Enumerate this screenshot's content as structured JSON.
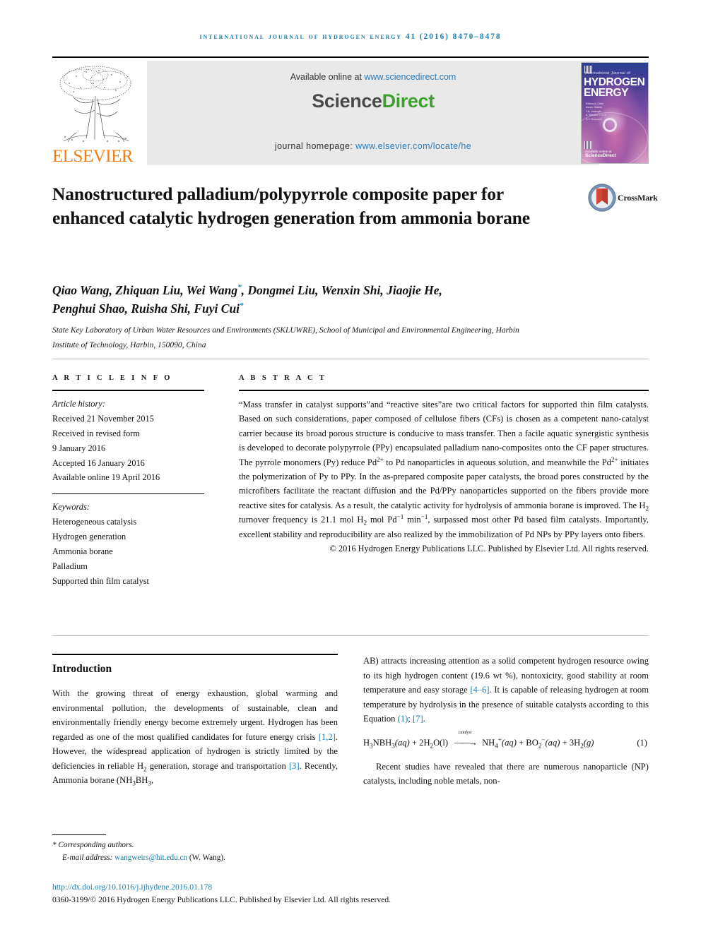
{
  "running_head": "international journal of hydrogen energy 41 (2016) 8470–8478",
  "banner": {
    "available_prefix": "Available online at ",
    "available_url": "www.sciencedirect.com",
    "logo_sci": "Science",
    "logo_direct": "Direct",
    "homepage_prefix": "journal homepage: ",
    "homepage_url": "www.elsevier.com/locate/he",
    "elsevier_wordmark": "ELSEVIER",
    "cover": {
      "line_small": "International Journal of",
      "line_big_1": "HYDROGEN",
      "line_big_2": "ENERGY",
      "editors": "Editors-in-Chief: T. Nejat Veziroglu\nAssociate Editors: A. Mahdavi, C.C. Sorrelon, R.H. Alonsoke,\nD.Y. Goswami, M. Bolhain,\nLu-Chu Tsai, E. and C.C. Sorrelon",
      "sciencedirect": "ScienceDirect",
      "sciencedirect_small": "Available online at"
    }
  },
  "crossmark": {
    "label": "CrossMark"
  },
  "title": "Nanostructured palladium/polypyrrole composite paper for enhanced catalytic hydrogen generation from ammonia borane",
  "authors_line1_a": "Qiao Wang, Zhiquan Liu, Wei Wang",
  "authors_line1_b": ", Dongmei Liu, Wenxin Shi, Jiaojie He,",
  "authors_line2_a": "Penghui Shao, Ruisha Shi, Fuyi Cui",
  "author_star": "*",
  "affiliation": "State Key Laboratory of Urban Water Resources and Environments (SKLUWRE), School of Municipal and Environmental Engineering, Harbin Institute of Technology, Harbin, 150090, China",
  "article_info": {
    "heading": "A R T I C L E   I N F O",
    "history_label": "Article history:",
    "history": [
      "Received 21 November 2015",
      "Received in revised form",
      "9 January 2016",
      "Accepted 16 January 2016",
      "Available online 19 April 2016"
    ],
    "keywords_label": "Keywords:",
    "keywords": [
      "Heterogeneous catalysis",
      "Hydrogen generation",
      "Ammonia borane",
      "Palladium",
      "Supported thin film catalyst"
    ]
  },
  "abstract": {
    "heading": "A B S T R A C T",
    "p1_a": "“Mass transfer in catalyst supports”and “reactive sites”are two critical factors for supported thin film catalysts. Based on such considerations, paper composed of cellulose fibers (CFs) is chosen as a competent nano-catalyst carrier because its broad porous structure is conducive to mass transfer. Then a facile aquatic synergistic synthesis is developed to decorate polypyrrole (PPy) encapsulated palladium nano-composites onto the CF paper structures. The pyrrole monomers (Py) reduce Pd",
    "sup1": "2+",
    "p1_b": " to Pd nanoparticles in aqueous solution, and meanwhile the Pd",
    "sup2": "2+",
    "p1_c": " initiates the polymerization of Py to PPy. In the as-prepared composite paper catalysts, the broad pores constructed by the microfibers facilitate the reactant diffusion and the Pd/PPy nanoparticles supported on the fibers provide more reactive sites for catalysis. As a result, the catalytic activity for hydrolysis of ammonia borane is improved. The H",
    "sub_h2a": "2",
    "p1_d": " turnover frequency is 21.1 mol H",
    "sub_h2b": "2",
    "p1_e": " mol Pd",
    "sup_neg1a": "−1",
    "p1_f": " min",
    "sup_neg1b": "−1",
    "p1_g": ", surpassed most other Pd based film catalysts. Importantly, excellent stability and reproducibility are also realized by the immobilization of Pd NPs by PPy layers onto fibers.",
    "copyright": "© 2016 Hydrogen Energy Publications LLC. Published by Elsevier Ltd. All rights reserved."
  },
  "body": {
    "intro_heading": "Introduction",
    "left_p1_a": "With the growing threat of energy exhaustion, global warming and environmental pollution, the developments of sustainable, clean and environmentally friendly energy become extremely urgent. Hydrogen has been regarded as one of the most qualified candidates for future energy crisis ",
    "left_cite_12": "[1,2]",
    "left_p1_b": ". However, the widespread application of hydrogen is strictly limited by the deficiencies in reliable H",
    "left_sub_2": "2",
    "left_p1_c": " generation, storage and transportation ",
    "left_cite_3": "[3]",
    "left_p1_d": ". Recently, Ammonia borane (NH",
    "left_sub_3a": "3",
    "left_p1_e": "BH",
    "left_sub_3b": "3",
    "left_p1_f": ",",
    "right_p1_a": "AB) attracts increasing attention as a solid competent hydrogen resource owing to its high hydrogen content (19.6 wt %), nontoxicity, good stability at room temperature and easy storage ",
    "right_cite_46": "[4–6]",
    "right_p1_b": ". It is capable of releasing hydrogen at room temperature by hydrolysis in the presence of suitable catalysts according to this Equation ",
    "right_cite_eq1": "(1)",
    "right_p1_c": "; ",
    "right_cite_7": "[7]",
    "right_p1_d": ".",
    "equation": {
      "lhs_h3": "H",
      "lhs_sub3a": "3",
      "lhs_nbh": "NBH",
      "lhs_sub3b": "3",
      "lhs_aq": "(aq)",
      "plus1": " + 2H",
      "lhs_sub2": "2",
      "lhs_o": "O(l)",
      "arrow_label": "catalyst",
      "rhs_nh4": "NH",
      "rhs_sub4": "4",
      "rhs_sup_plus": "+",
      "rhs_aq1": "(aq)",
      "plus2": " + BO",
      "rhs_sub2": "2",
      "rhs_sup_minus": "−",
      "rhs_aq2": "(aq)",
      "plus3": " + 3H",
      "rhs_sub2b": "2",
      "rhs_g": "(g)",
      "number": "(1)"
    },
    "right_p2": "Recent studies have revealed that there are numerous nanoparticle (NP) catalysts, including noble metals, non-"
  },
  "footer": {
    "corresponding": "* Corresponding authors.",
    "email_label": "E-mail address: ",
    "email": "wangweirs@hit.edu.cn",
    "email_suffix": " (W. Wang).",
    "doi": "http://dx.doi.org/10.1016/j.ijhydene.2016.01.178",
    "issn_line": "0360-3199/© 2016 Hydrogen Energy Publications LLC. Published by Elsevier Ltd. All rights reserved."
  },
  "colors": {
    "link": "#1a7eb0",
    "elsevier_orange": "#f07f1a",
    "sciencedirect_green": "#3ba32b",
    "crossmark_blue": "#5b7fa6"
  }
}
